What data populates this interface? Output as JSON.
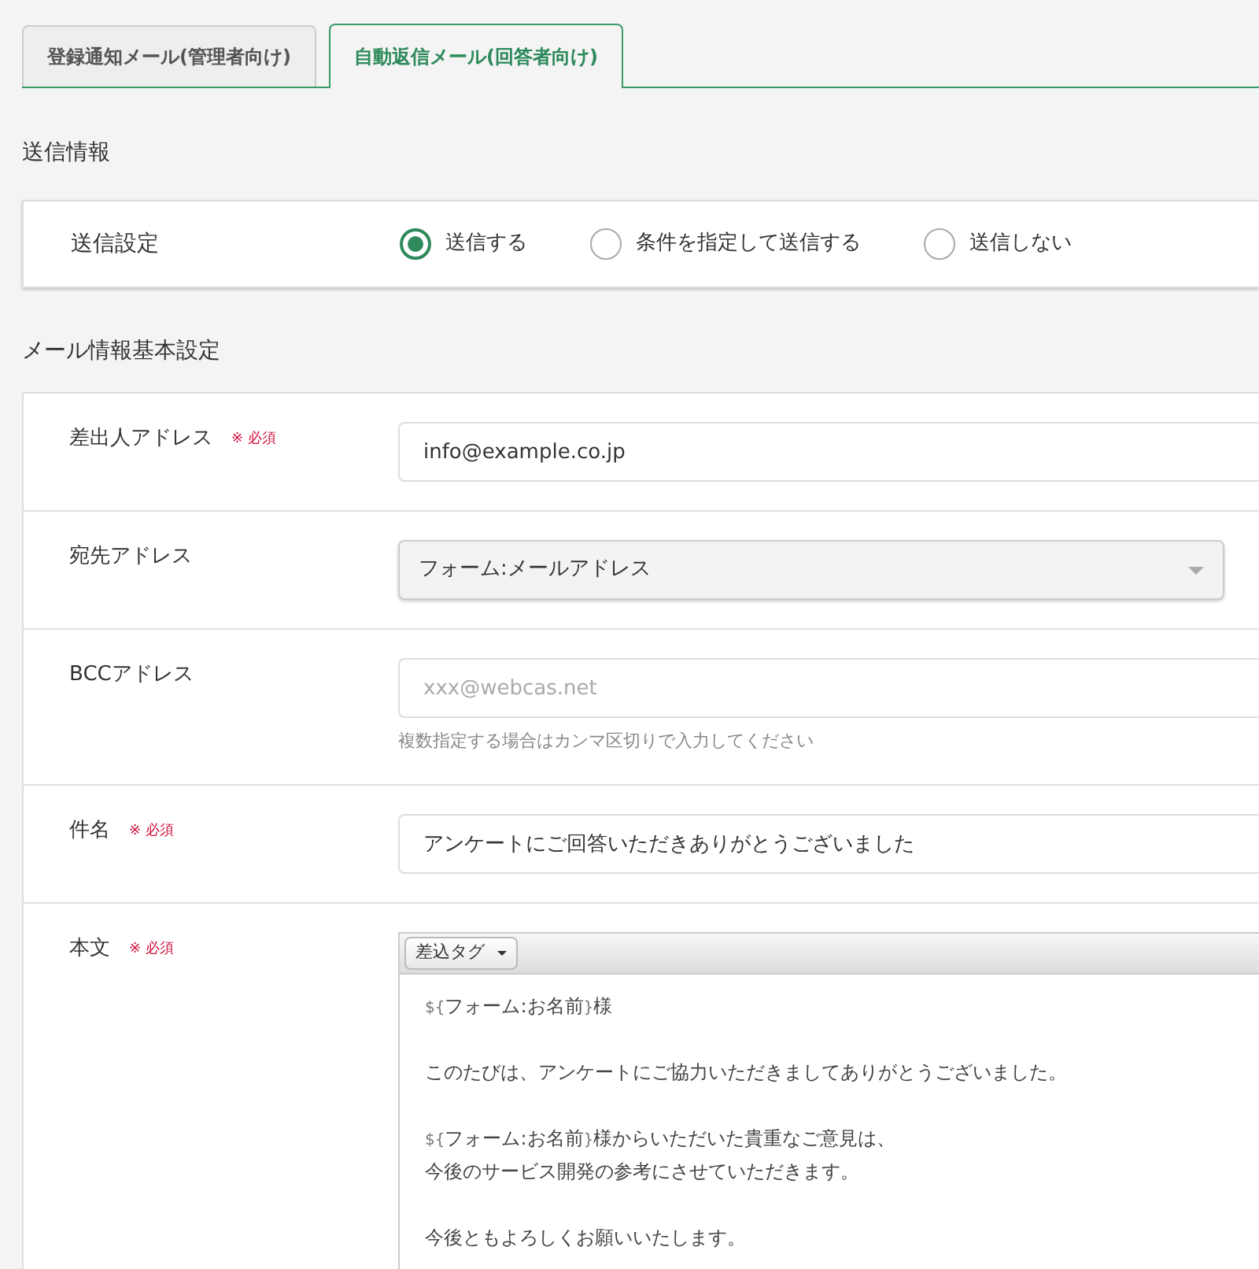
{
  "tabs": [
    {
      "label": "登録通知メール(管理者向け)",
      "selected": false
    },
    {
      "label": "自動返信メール(回答者向け)",
      "selected": true
    }
  ],
  "send_section": {
    "title": "送信情報",
    "label": "送信設定",
    "options": [
      {
        "label": "送信する",
        "selected": true
      },
      {
        "label": "条件を指定して送信する",
        "selected": false
      },
      {
        "label": "送信しない",
        "selected": false
      }
    ]
  },
  "mail_section": {
    "title": "メール情報基本設定",
    "rows": [
      {
        "kind": "input",
        "label": "差出人アドレス",
        "required_mark": "※ 必須",
        "value": "info@example.co.jp"
      },
      {
        "kind": "select",
        "label": "宛先アドレス",
        "value": "フォーム:メールアドレス"
      },
      {
        "kind": "input",
        "label": "BCCアドレス",
        "placeholder": "xxx@webcas.net",
        "help": "複数指定する場合はカンマ区切りで入力してください"
      },
      {
        "kind": "input",
        "label": "件名",
        "required_mark": "※ 必須",
        "value": "アンケートにご回答いただきありがとうございました"
      },
      {
        "kind": "editor",
        "label": "本文",
        "required_mark": "※ 必須",
        "toolbar_button": "差込タグ",
        "paragraphs": [
          [
            [
              {
                "kind": "tag",
                "text": "${"
              },
              {
                "kind": "text",
                "text": "フォーム:お名前"
              },
              {
                "kind": "tag",
                "text": "}"
              },
              {
                "kind": "text",
                "text": "様"
              }
            ]
          ],
          [
            [
              {
                "kind": "text",
                "text": "このたびは、アンケートにご協力いただきましてありがとうございました。"
              }
            ]
          ],
          [
            [
              {
                "kind": "tag",
                "text": "${"
              },
              {
                "kind": "text",
                "text": "フォーム:お名前"
              },
              {
                "kind": "tag",
                "text": "}"
              },
              {
                "kind": "text",
                "text": "様からいただいた貴重なご意見は、"
              }
            ],
            [
              {
                "kind": "text",
                "text": "今後のサービス開発の参考にさせていただきます。"
              }
            ]
          ],
          [
            [
              {
                "kind": "text",
                "text": "今後ともよろしくお願いいたします。"
              }
            ]
          ]
        ]
      }
    ]
  }
}
